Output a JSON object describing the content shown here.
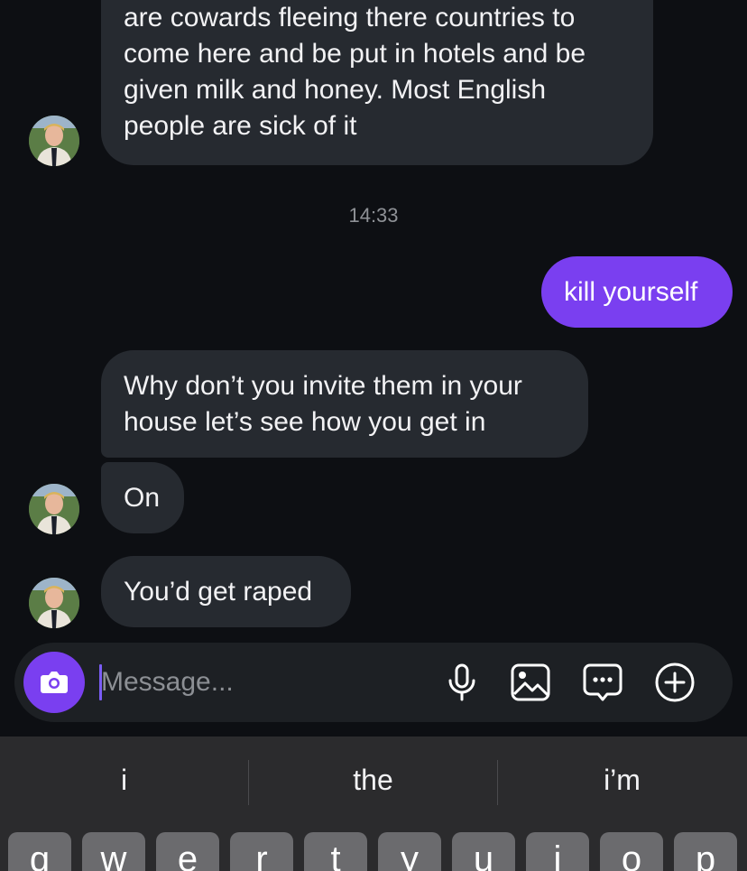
{
  "messages": [
    {
      "direction": "incoming",
      "text": "are cowards fleeing there countries to\ncome here and be put in hotels and be\ngiven milk and honey. Most English\npeople are sick of it"
    },
    {
      "direction": "outgoing",
      "text": "kill yourself"
    },
    {
      "direction": "incoming",
      "text": "Why don’t you invite them in your\nhouse let’s see how you get in"
    },
    {
      "direction": "incoming",
      "text": "On"
    },
    {
      "direction": "incoming",
      "text": "You’d get raped"
    }
  ],
  "timestamp": "14:33",
  "composer": {
    "placeholder": "Message...",
    "value": "",
    "icons": [
      "camera-icon",
      "microphone-icon",
      "image-icon",
      "chat-bubble-icon",
      "plus-circle-icon"
    ]
  },
  "keyboard": {
    "suggestions": [
      "i",
      "the",
      "i’m"
    ],
    "top_row": [
      "q",
      "w",
      "e",
      "r",
      "t",
      "y",
      "u",
      "i",
      "o",
      "p"
    ]
  },
  "colors": {
    "background": "#0d0f13",
    "incoming_bubble": "#262a30",
    "outgoing_bubble": "#7a3ff0",
    "accent": "#7a3ff0"
  }
}
